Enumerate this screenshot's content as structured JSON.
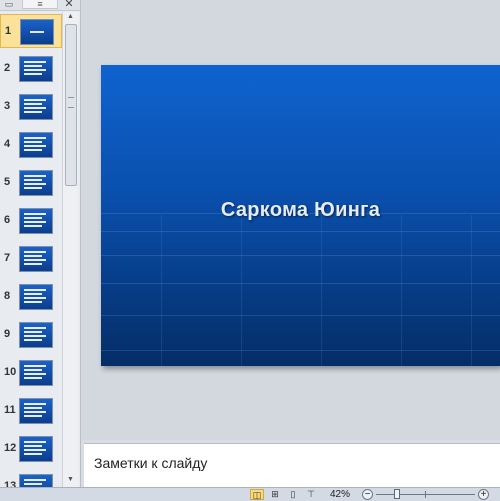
{
  "pane": {
    "tab_outline_icon": "outline-list-icon",
    "close_glyph": "✕"
  },
  "thumbnails": [
    {
      "num": "1"
    },
    {
      "num": "2"
    },
    {
      "num": "3"
    },
    {
      "num": "4"
    },
    {
      "num": "5"
    },
    {
      "num": "6"
    },
    {
      "num": "7"
    },
    {
      "num": "8"
    },
    {
      "num": "9"
    },
    {
      "num": "10"
    },
    {
      "num": "11"
    },
    {
      "num": "12"
    },
    {
      "num": "13"
    }
  ],
  "selected_slide": "1",
  "slide": {
    "title": "Саркома  Юинга"
  },
  "notes": {
    "placeholder": "Заметки к слайду"
  },
  "status": {
    "zoom": "42%",
    "zoom_out_glyph": "−",
    "zoom_in_glyph": "+"
  },
  "colors": {
    "slide_accent": "#0a51b0",
    "selected_highlight": "#fbe29a"
  }
}
